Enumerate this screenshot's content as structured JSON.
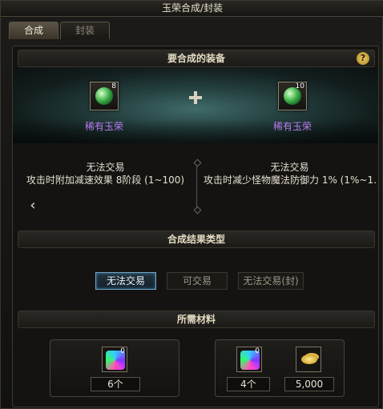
{
  "window": {
    "title": "玉荣合成/封装"
  },
  "tabs": [
    {
      "label": "合成",
      "active": true
    },
    {
      "label": "封装",
      "active": false
    }
  ],
  "equip_section": {
    "title": "要合成的装备",
    "help_icon": "?",
    "left_item": {
      "name": "稀有玉荣",
      "count": "8",
      "icon": "green-gem-icon"
    },
    "right_item": {
      "name": "稀有玉荣",
      "count": "10",
      "icon": "green-gem-icon"
    },
    "left_desc": {
      "line1": "无法交易",
      "line2": "攻击时附加减速效果 8阶段 (1~100)"
    },
    "right_desc": {
      "line1": "无法交易",
      "line2": "攻击时减少怪物魔法防御力 1% (1%~1…"
    }
  },
  "result_section": {
    "title": "合成结果类型",
    "options": [
      "无法交易",
      "可交易",
      "无法交易(封)"
    ],
    "selected": "无法交易"
  },
  "materials_section": {
    "title": "所需材料",
    "left_box": {
      "slot_count": "0",
      "quantity": "6个"
    },
    "right_box": {
      "slot_count": "0",
      "quantity": "4个",
      "gold": "5,000"
    }
  },
  "colors": {
    "rare_item": "#b87cf2",
    "selected_option": "#6fa6c8"
  }
}
